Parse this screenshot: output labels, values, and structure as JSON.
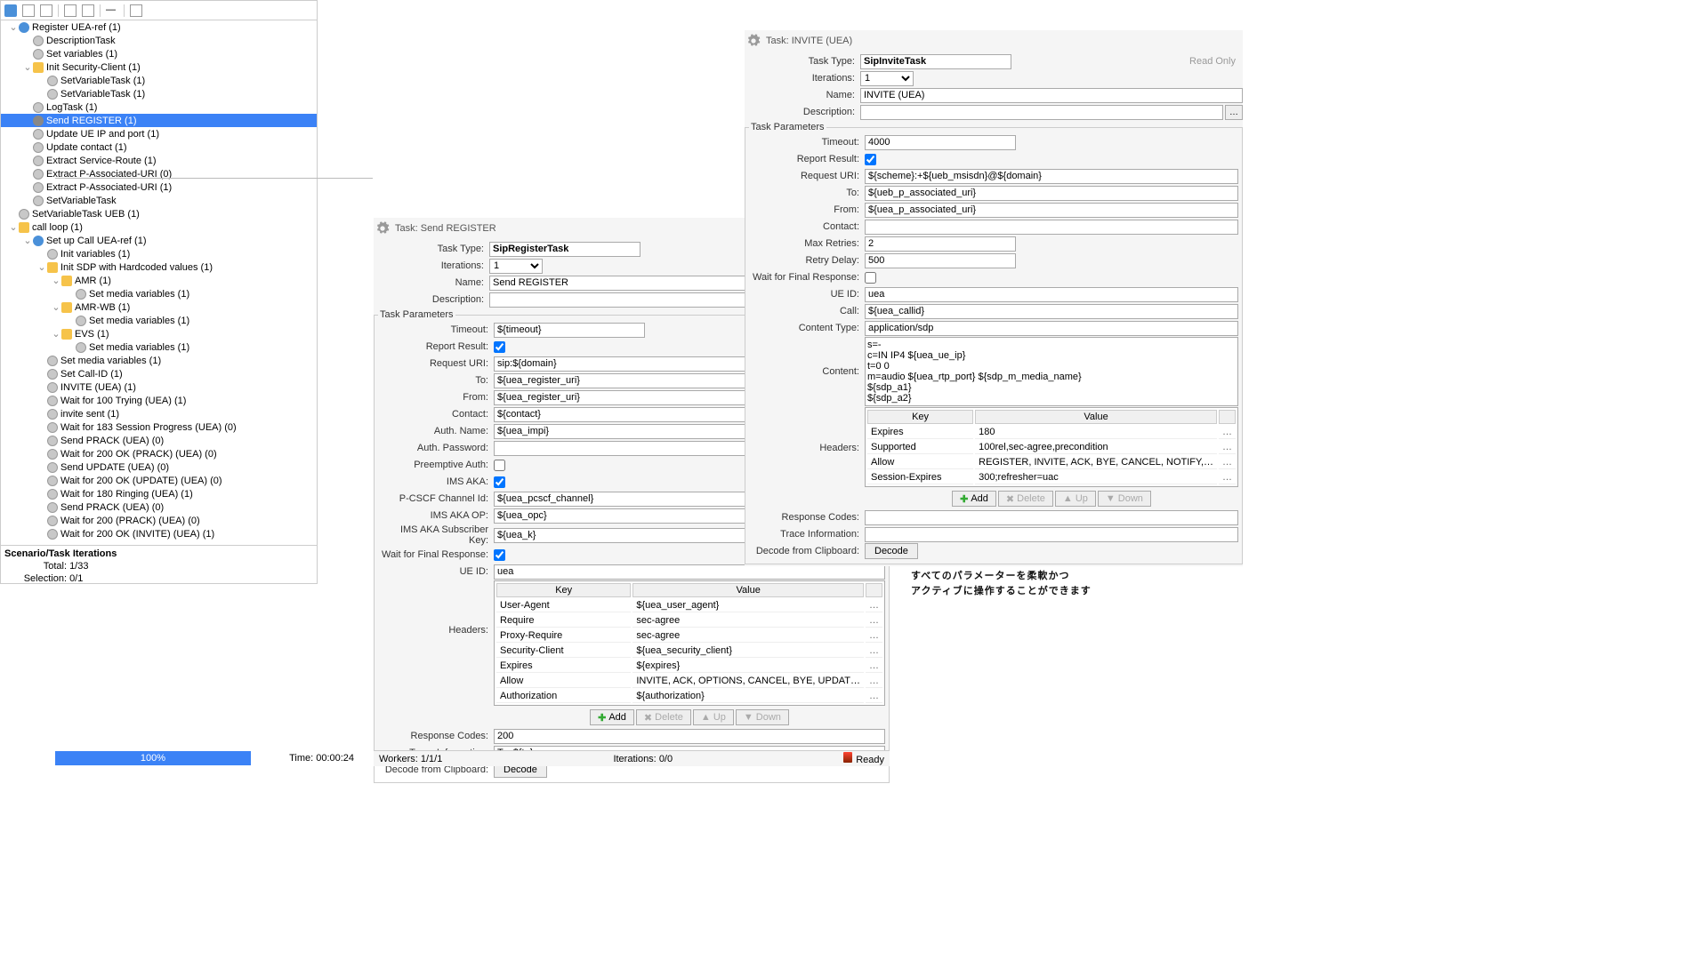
{
  "leftTree": {
    "items": [
      {
        "d": 0,
        "tw": "v",
        "ic": "shield",
        "t": "Register UEA-ref (1)"
      },
      {
        "d": 1,
        "tw": "",
        "ic": "circ",
        "t": "DescriptionTask"
      },
      {
        "d": 1,
        "tw": "",
        "ic": "circ",
        "t": "Set variables (1)"
      },
      {
        "d": 1,
        "tw": "v",
        "ic": "folder",
        "t": "Init Security-Client (1)"
      },
      {
        "d": 2,
        "tw": "",
        "ic": "circ",
        "t": "SetVariableTask (1)"
      },
      {
        "d": 2,
        "tw": "",
        "ic": "circ",
        "t": "SetVariableTask (1)"
      },
      {
        "d": 1,
        "tw": "",
        "ic": "circ",
        "t": "LogTask (1)"
      },
      {
        "d": 1,
        "tw": "",
        "ic": "play",
        "t": "Send REGISTER (1)",
        "sel": true
      },
      {
        "d": 1,
        "tw": "",
        "ic": "circ",
        "t": "Update UE IP and port (1)"
      },
      {
        "d": 1,
        "tw": "",
        "ic": "circ",
        "t": "Update contact (1)"
      },
      {
        "d": 1,
        "tw": "",
        "ic": "circ",
        "t": "Extract Service-Route (1)"
      },
      {
        "d": 1,
        "tw": "",
        "ic": "circ",
        "t": "Extract P-Associated-URI (0)"
      },
      {
        "d": 1,
        "tw": "",
        "ic": "circ",
        "t": "Extract P-Associated-URI (1)"
      },
      {
        "d": 1,
        "tw": "",
        "ic": "circ",
        "t": "SetVariableTask"
      },
      {
        "d": 0,
        "tw": "",
        "ic": "circ",
        "t": "SetVariableTask UEB (1)"
      },
      {
        "d": 0,
        "tw": "v",
        "ic": "folder",
        "t": "call loop (1)"
      },
      {
        "d": 1,
        "tw": "v",
        "ic": "shield",
        "t": "Set up Call UEA-ref (1)"
      },
      {
        "d": 2,
        "tw": "",
        "ic": "circ",
        "t": "Init variables (1)"
      },
      {
        "d": 2,
        "tw": "v",
        "ic": "folder",
        "t": "Init SDP with Hardcoded values (1)"
      },
      {
        "d": 3,
        "tw": "v",
        "ic": "folder",
        "t": "AMR (1)"
      },
      {
        "d": 4,
        "tw": "",
        "ic": "circ",
        "t": "Set media variables (1)"
      },
      {
        "d": 3,
        "tw": "v",
        "ic": "folder",
        "t": "AMR-WB (1)"
      },
      {
        "d": 4,
        "tw": "",
        "ic": "circ",
        "t": "Set media variables (1)"
      },
      {
        "d": 3,
        "tw": "v",
        "ic": "folder",
        "t": "EVS (1)"
      },
      {
        "d": 4,
        "tw": "",
        "ic": "circ",
        "t": "Set media variables (1)"
      },
      {
        "d": 2,
        "tw": "",
        "ic": "circ",
        "t": "Set media variables (1)"
      },
      {
        "d": 2,
        "tw": "",
        "ic": "circ",
        "t": "Set Call-ID (1)"
      },
      {
        "d": 2,
        "tw": "",
        "ic": "circ",
        "t": "INVITE (UEA) (1)"
      },
      {
        "d": 2,
        "tw": "",
        "ic": "circ",
        "t": "Wait for 100 Trying (UEA) (1)"
      },
      {
        "d": 2,
        "tw": "",
        "ic": "circ",
        "t": "invite sent (1)"
      },
      {
        "d": 2,
        "tw": "",
        "ic": "circ",
        "t": "Wait for 183 Session Progress (UEA) (0)"
      },
      {
        "d": 2,
        "tw": "",
        "ic": "circ",
        "t": "Send PRACK (UEA) (0)"
      },
      {
        "d": 2,
        "tw": "",
        "ic": "circ",
        "t": "Wait for 200 OK (PRACK) (UEA) (0)"
      },
      {
        "d": 2,
        "tw": "",
        "ic": "circ",
        "t": "Send UPDATE (UEA) (0)"
      },
      {
        "d": 2,
        "tw": "",
        "ic": "circ",
        "t": "Wait for 200 OK (UPDATE) (UEA) (0)"
      },
      {
        "d": 2,
        "tw": "",
        "ic": "circ",
        "t": "Wait for 180 Ringing (UEA) (1)"
      },
      {
        "d": 2,
        "tw": "",
        "ic": "circ",
        "t": "Send PRACK (UEA) (0)"
      },
      {
        "d": 2,
        "tw": "",
        "ic": "circ",
        "t": "Wait for 200 (PRACK) (UEA) (0)"
      },
      {
        "d": 2,
        "tw": "",
        "ic": "circ",
        "t": "Wait for 200 OK (INVITE) (UEA) (1)"
      }
    ],
    "stats": {
      "header": "Scenario/Task Iterations",
      "total_l": "Total:",
      "total_v": "1/33",
      "sel_l": "Selection:",
      "sel_v": "0/1",
      "progress": "100%",
      "time_l": "Time:",
      "time_v": "00:00:24"
    }
  },
  "mid": {
    "title": "Task: Send REGISTER",
    "taskType_l": "Task Type:",
    "taskType": "SipRegisterTask",
    "iter_l": "Iterations:",
    "iter": "1",
    "name_l": "Name:",
    "name": "Send REGISTER",
    "desc_l": "Description:",
    "desc": "",
    "fs": "Task Parameters",
    "timeout_l": "Timeout:",
    "timeout": "${timeout}",
    "report_l": "Report Result:",
    "reqUri_l": "Request URI:",
    "reqUri": "sip:${domain}",
    "to_l": "To:",
    "to": "${uea_register_uri}",
    "from_l": "From:",
    "from": "${uea_register_uri}",
    "contact_l": "Contact:",
    "contact": "${contact}",
    "authName_l": "Auth. Name:",
    "authName": "${uea_impi}",
    "authPw_l": "Auth. Password:",
    "authPw": "",
    "preemp_l": "Preemptive Auth:",
    "imsAka_l": "IMS AKA:",
    "pcsf_l": "P-CSCF Channel Id:",
    "pcsf": "${uea_pcscf_channel}",
    "akaOp_l": "IMS AKA OP:",
    "akaOp": "${uea_opc}",
    "akaSub_l": "IMS AKA Subscriber Key:",
    "akaSub": "${uea_k}",
    "waitFinal_l": "Wait for Final Response:",
    "ueid_l": "UE ID:",
    "ueid": "uea",
    "headers_l": "Headers:",
    "hdrKey": "Key",
    "hdrVal": "Value",
    "headerRows": [
      {
        "k": "User-Agent",
        "v": "${uea_user_agent}"
      },
      {
        "k": "Require",
        "v": "sec-agree"
      },
      {
        "k": "Proxy-Require",
        "v": "sec-agree"
      },
      {
        "k": "Security-Client",
        "v": "${uea_security_client}"
      },
      {
        "k": "Expires",
        "v": "${expires}"
      },
      {
        "k": "Allow",
        "v": "INVITE, ACK, OPTIONS, CANCEL, BYE, UPDAT…"
      },
      {
        "k": "Authorization",
        "v": "${authorization}"
      }
    ],
    "btnAdd": "Add",
    "btnDel": "Delete",
    "btnUp": "Up",
    "btnDown": "Down",
    "respCodes_l": "Response Codes:",
    "respCodes": "200",
    "trace_l": "Trace Information:",
    "trace": "To: ${to}",
    "decode_l": "Decode from Clipboard:",
    "decode": "Decode",
    "workers_l": "Workers:",
    "workers": "1/1/1",
    "iterStat_l": "Iterations:",
    "iterStat": "0/0",
    "ready": "Ready"
  },
  "right": {
    "title": "Task: INVITE (UEA)",
    "ro": "Read Only",
    "taskType_l": "Task Type:",
    "taskType": "SipInviteTask",
    "iter_l": "Iterations:",
    "iter": "1",
    "name_l": "Name:",
    "name": "INVITE (UEA)",
    "desc_l": "Description:",
    "desc": "",
    "fs": "Task Parameters",
    "timeout_l": "Timeout:",
    "timeout": "4000",
    "report_l": "Report Result:",
    "reqUri_l": "Request URI:",
    "reqUri": "${scheme}:+${ueb_msisdn}@${domain}",
    "to_l": "To:",
    "to": "${ueb_p_associated_uri}",
    "from_l": "From:",
    "from": "${uea_p_associated_uri}",
    "contact_l": "Contact:",
    "contact": "",
    "maxRetry_l": "Max Retries:",
    "maxRetry": "2",
    "retryDelay_l": "Retry Delay:",
    "retryDelay": "500",
    "waitFinal_l": "Wait for Final Response:",
    "ueid_l": "UE ID:",
    "ueid": "uea",
    "call_l": "Call:",
    "call": "${uea_callid}",
    "ctype_l": "Content Type:",
    "ctype": "application/sdp",
    "content_l": "Content:",
    "content": "s=-\nc=IN IP4 ${uea_ue_ip}\nt=0 0\nm=audio ${uea_rtp_port} ${sdp_m_media_name}\n${sdp_a1}\n${sdp_a2}",
    "headers_l": "Headers:",
    "hdrKey": "Key",
    "hdrVal": "Value",
    "headerRows": [
      {
        "k": "Expires",
        "v": "180"
      },
      {
        "k": "Supported",
        "v": "100rel,sec-agree,precondition"
      },
      {
        "k": "Allow",
        "v": "REGISTER, INVITE, ACK, BYE, CANCEL, NOTIFY,…"
      },
      {
        "k": "Session-Expires",
        "v": "300;refresher=uac"
      }
    ],
    "btnAdd": "Add",
    "btnDel": "Delete",
    "btnUp": "Up",
    "btnDown": "Down",
    "respCodes_l": "Response Codes:",
    "respCodes": "",
    "trace_l": "Trace Information:",
    "trace": "",
    "decode_l": "Decode from Clipboard:",
    "decode": "Decode"
  },
  "caption_l1": "すべてのパラメーターを柔軟かつ",
  "caption_l2": "アクティブに操作することができます"
}
